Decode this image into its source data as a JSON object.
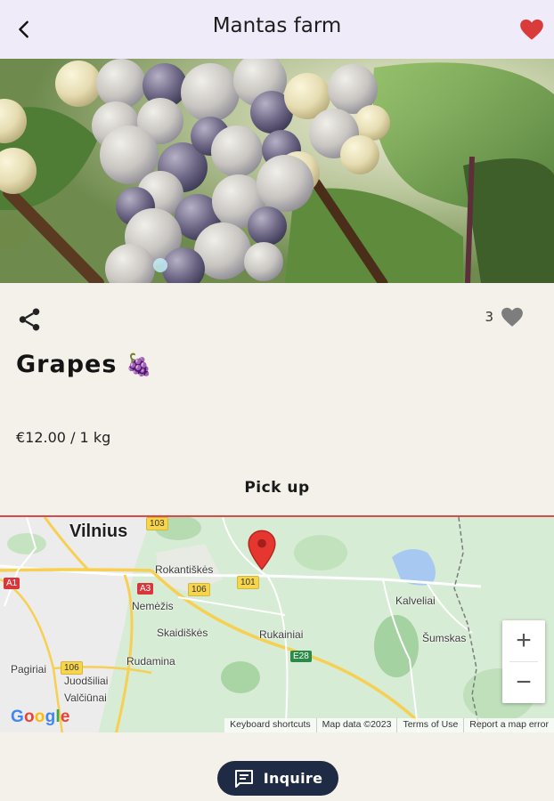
{
  "header": {
    "title": "Mantas farm",
    "back_icon": "chevron-left-icon",
    "favorite_icon": "heart-icon",
    "favorite_color": "#d93b3b"
  },
  "photo": {
    "subject": "grapes-on-vine"
  },
  "product": {
    "name": "Grapes",
    "emoji": "🍇",
    "share_icon": "share-icon",
    "like_count": "3",
    "like_icon": "heart-icon",
    "price": "€12.00 / 1 kg"
  },
  "pickup": {
    "label": "Pick up"
  },
  "map": {
    "city": "Vilnius",
    "places": [
      "Rokantiškės",
      "Nemėžis",
      "Skaidiškės",
      "Rukainiai",
      "Rudamina",
      "Pagiriai",
      "Juodšiliai",
      "Valčiūnai",
      "Kalveliai",
      "Šumskas"
    ],
    "roads": [
      "103",
      "A1",
      "A3",
      "106",
      "101",
      "E28",
      "106"
    ],
    "zoom_in": "+",
    "zoom_out": "−",
    "google": "Google",
    "footer": {
      "shortcuts": "Keyboard shortcuts",
      "data": "Map data ©2023",
      "terms": "Terms of Use",
      "report": "Report a map error"
    }
  },
  "actions": {
    "inquire_label": "Inquire",
    "inquire_icon": "message-icon"
  }
}
